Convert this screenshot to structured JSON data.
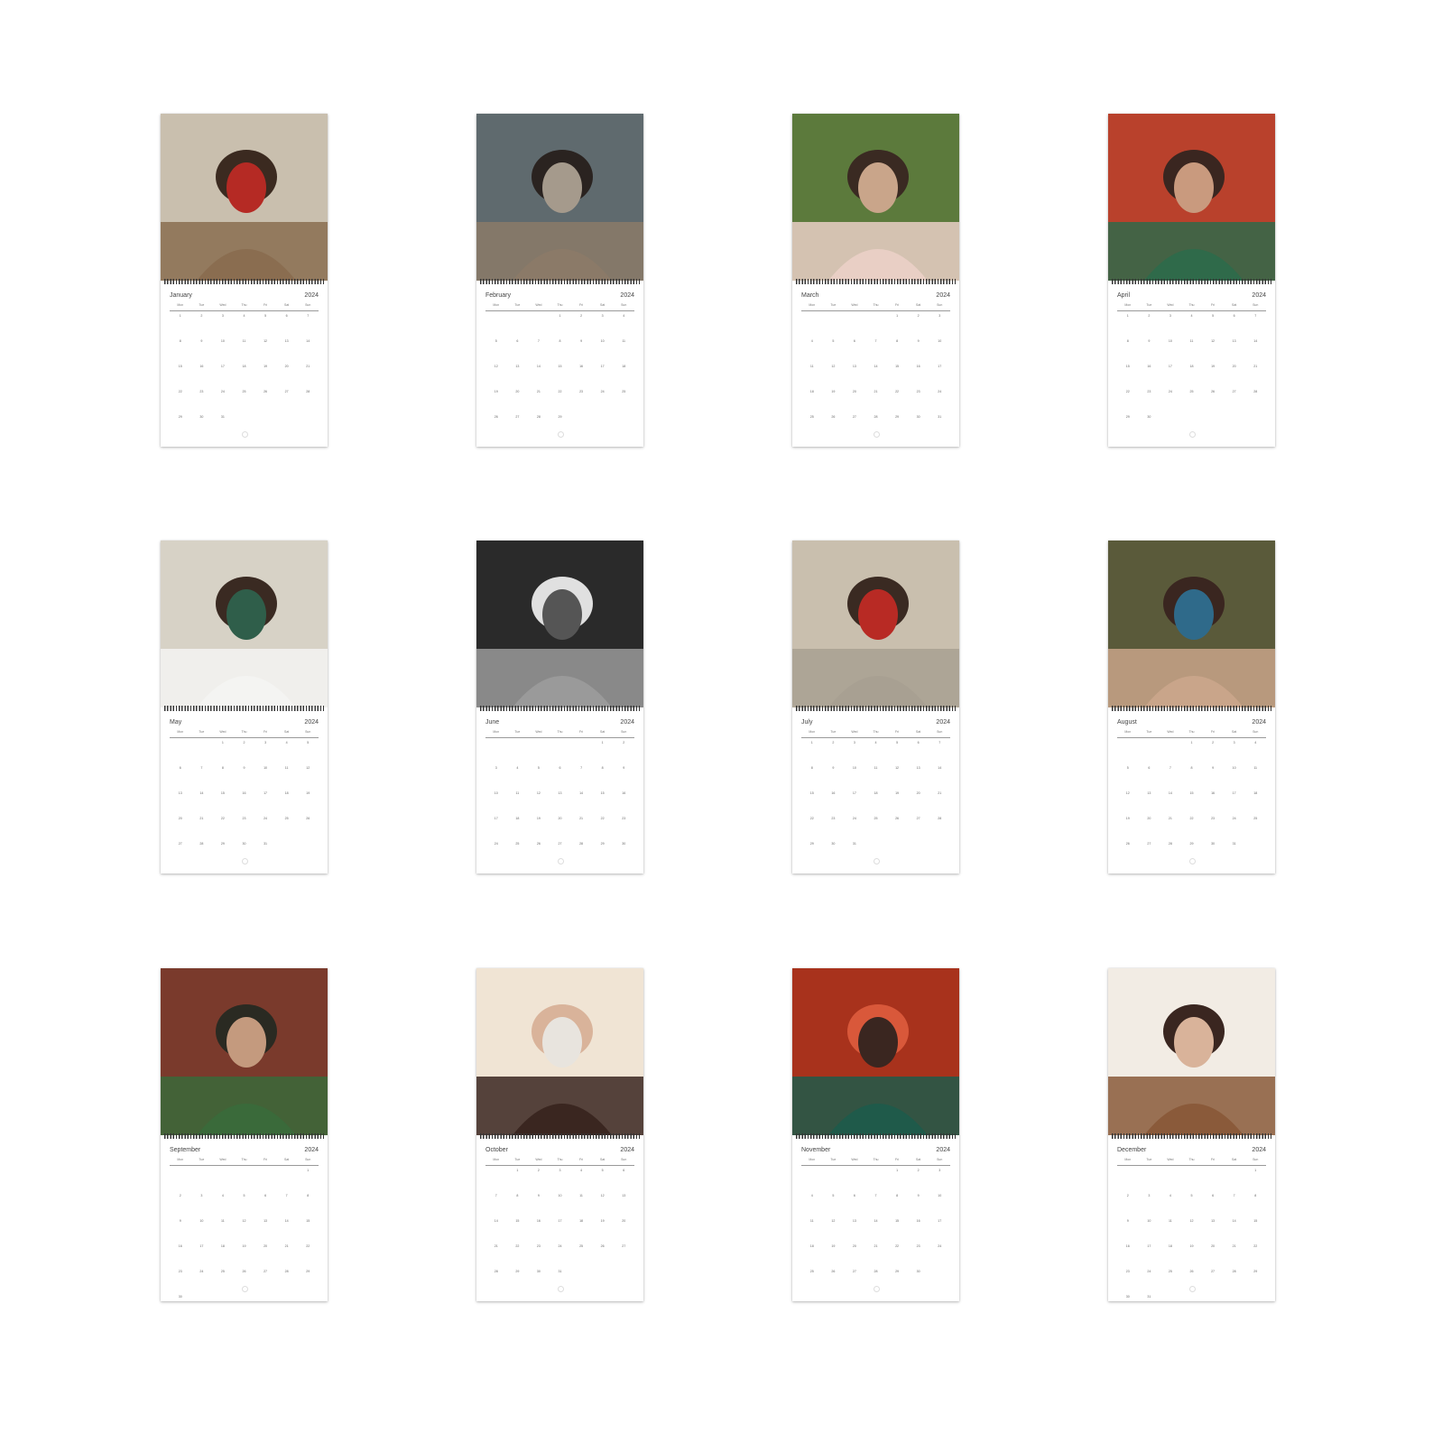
{
  "year": "2024",
  "weekdays": [
    "Mon",
    "Tue",
    "Wed",
    "Thu",
    "Fri",
    "Sat",
    "Sun"
  ],
  "months": [
    {
      "name": "January",
      "offset": 0,
      "days": 31,
      "palette": [
        "#c9bfae",
        "#8a6d50",
        "#3b2a20",
        "#b52a24"
      ]
    },
    {
      "name": "February",
      "offset": 3,
      "days": 29,
      "palette": [
        "#5f6a6e",
        "#8b7a68",
        "#2a2320",
        "#a59a8c"
      ]
    },
    {
      "name": "March",
      "offset": 4,
      "days": 31,
      "palette": [
        "#5c7a3c",
        "#e9cfc5",
        "#3a2a22",
        "#c9a58a"
      ]
    },
    {
      "name": "April",
      "offset": 0,
      "days": 30,
      "palette": [
        "#b9412c",
        "#2f6a4a",
        "#3a2620",
        "#c99a7e"
      ]
    },
    {
      "name": "May",
      "offset": 2,
      "days": 31,
      "palette": [
        "#d7d2c6",
        "#f4f4f2",
        "#3a2a22",
        "#2f5e4a"
      ]
    },
    {
      "name": "June",
      "offset": 5,
      "days": 30,
      "palette": [
        "#2a2a2a",
        "#9a9a9a",
        "#e0e0e0",
        "#555555"
      ]
    },
    {
      "name": "July",
      "offset": 0,
      "days": 31,
      "palette": [
        "#c9bfae",
        "#a8a092",
        "#3a2a22",
        "#b82a24"
      ]
    },
    {
      "name": "August",
      "offset": 3,
      "days": 31,
      "palette": [
        "#5a5a3a",
        "#c9a58a",
        "#3a2620",
        "#2f6a8a"
      ]
    },
    {
      "name": "September",
      "offset": 6,
      "days": 30,
      "palette": [
        "#7a3a2c",
        "#3a6a3a",
        "#2a2a22",
        "#c49a7e"
      ]
    },
    {
      "name": "October",
      "offset": 1,
      "days": 31,
      "palette": [
        "#f0e4d4",
        "#3a2620",
        "#d9b39a",
        "#e8e4de"
      ]
    },
    {
      "name": "November",
      "offset": 4,
      "days": 30,
      "palette": [
        "#a8321c",
        "#1f5a4a",
        "#d9583a",
        "#3a2620"
      ]
    },
    {
      "name": "December",
      "offset": 6,
      "days": 31,
      "palette": [
        "#f2ece4",
        "#8a5a3a",
        "#3a2620",
        "#d9b39a"
      ]
    }
  ]
}
